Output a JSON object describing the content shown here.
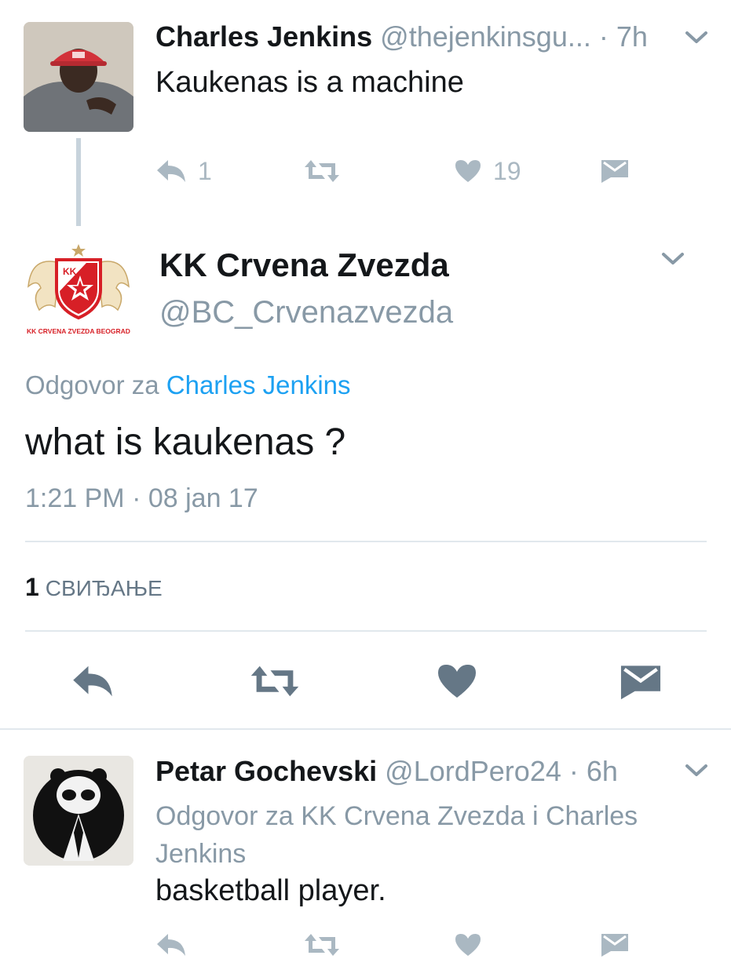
{
  "tweet1": {
    "name": "Charles Jenkins",
    "handle": "@thejenkinsgu...",
    "time": "· 7h",
    "text": "Kaukenas is a machine",
    "reply_count": "1",
    "like_count": "19"
  },
  "tweet2": {
    "name": "KK Crvena Zvezda",
    "handle": "@BC_Crvenazvezda",
    "logo_badge": "KK",
    "logo_caption": "KK CRVENA ZVEZDA BEOGRAD",
    "reply_prefix": "Odgovor za",
    "reply_to": "Charles Jenkins",
    "text": "what is kaukenas ?",
    "timestamp": "1:21 PM · 08 jan 17",
    "likes_count": "1",
    "likes_label": "СВИЂАЊЕ"
  },
  "tweet3": {
    "name": "Petar Gochevski",
    "handle": "@LordPero24",
    "time": "· 6h",
    "reply_line": "Odgovor za KK Crvena Zvezda i Charles Jenkins",
    "text": "basketball player."
  },
  "icons": [
    "reply-icon",
    "retweet-icon",
    "heart-icon",
    "direct-message-icon",
    "chevron-down-icon"
  ],
  "colors": {
    "link": "#1da1f2",
    "icon_gray": "#8899a6",
    "light_icon": "#aab8c2",
    "logo_red": "#d71f26"
  }
}
